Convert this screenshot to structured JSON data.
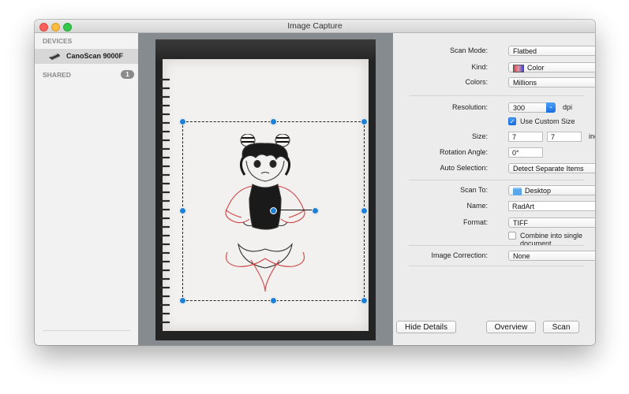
{
  "window": {
    "title": "Image Capture"
  },
  "sidebar": {
    "devices_header": "DEVICES",
    "device_name": "CanoScan 9000F",
    "shared_header": "SHARED",
    "shared_count": "1"
  },
  "settings": {
    "scan_mode_label": "Scan Mode:",
    "scan_mode_value": "Flatbed",
    "kind_label": "Kind:",
    "kind_value": "Color",
    "colors_label": "Colors:",
    "colors_value": "Millions",
    "resolution_label": "Resolution:",
    "resolution_value": "300",
    "resolution_unit": "dpi",
    "custom_size_label": "Use Custom Size",
    "custom_size_checked": true,
    "size_label": "Size:",
    "size_width": "7",
    "size_height": "7",
    "size_unit": "inches",
    "rotation_label": "Rotation Angle:",
    "rotation_value": "0°",
    "auto_selection_label": "Auto Selection:",
    "auto_selection_value": "Detect Separate Items",
    "scan_to_label": "Scan To:",
    "scan_to_value": "Desktop",
    "name_label": "Name:",
    "name_value": "RadArt",
    "format_label": "Format:",
    "format_value": "TIFF",
    "combine_label": "Combine into single document",
    "combine_checked": false,
    "image_correction_label": "Image Correction:",
    "image_correction_value": "None"
  },
  "buttons": {
    "hide_details": "Hide Details",
    "overview": "Overview",
    "scan": "Scan"
  },
  "colors": {
    "accent": "#1a6ee0",
    "handle": "#1e7fd6",
    "preview_background": "#868b90"
  }
}
